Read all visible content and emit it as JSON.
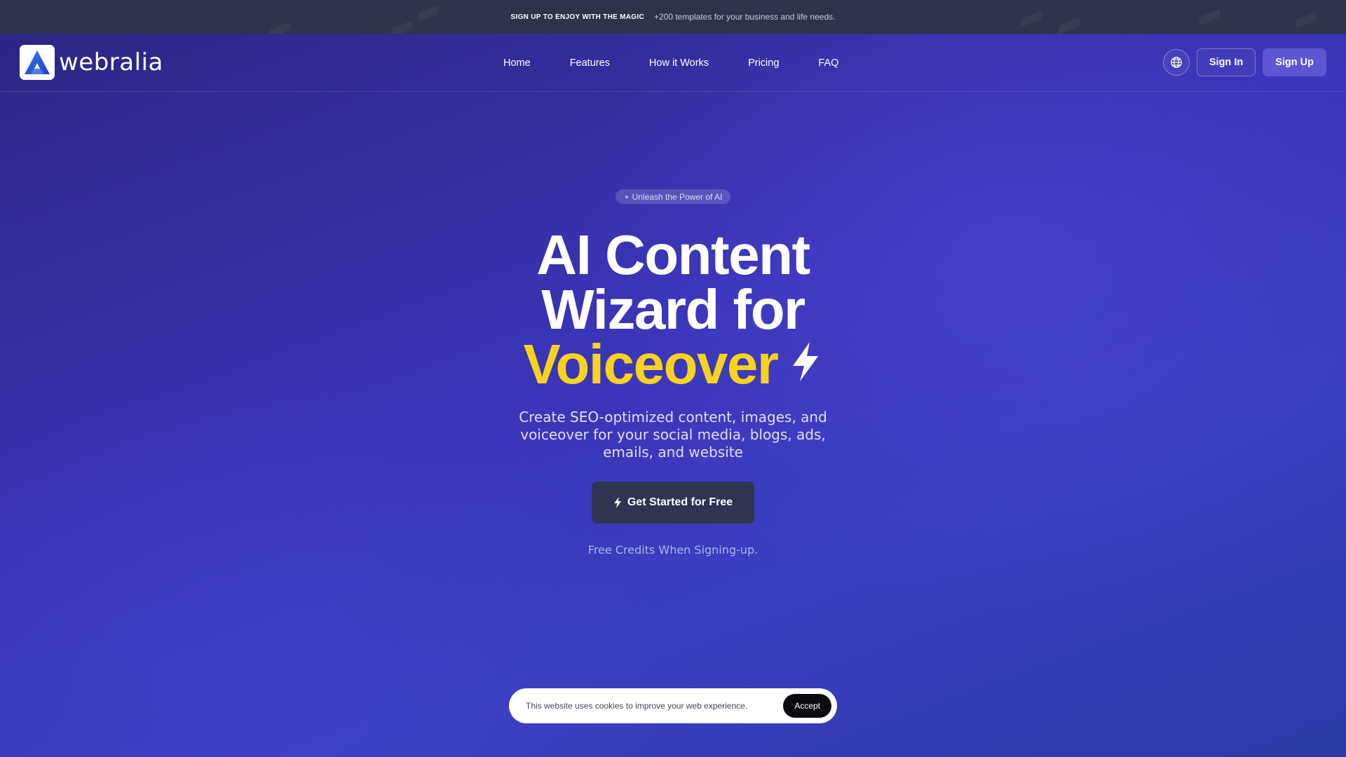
{
  "announcement": {
    "strong": "SIGN UP TO ENJOY WITH THE MAGIC",
    "text": "+200 templates for your business and life needs."
  },
  "header": {
    "logo_text": "webralia",
    "nav": [
      "Home",
      "Features",
      "How it Works",
      "Pricing",
      "FAQ"
    ],
    "sign_in": "Sign In",
    "sign_up": "Sign Up",
    "language_icon": "globe-icon"
  },
  "hero": {
    "badge": "Unleash the Power of AI",
    "headline_line1": "AI Content",
    "headline_line2": "Wizard for",
    "headline_highlight": "Voiceover",
    "subtitle": "Create SEO-optimized content, images, and voiceover for your social media, blogs, ads, emails, and website",
    "cta": "Get Started for Free",
    "note": "Free Credits When Signing-up."
  },
  "cookie": {
    "text": "This website uses cookies to improve your web experience.",
    "accept": "Accept"
  },
  "colors": {
    "highlight": "#f7d31c",
    "topbar": "#2d3348",
    "cta": "#2f3550",
    "signup": "#5a56d4"
  }
}
